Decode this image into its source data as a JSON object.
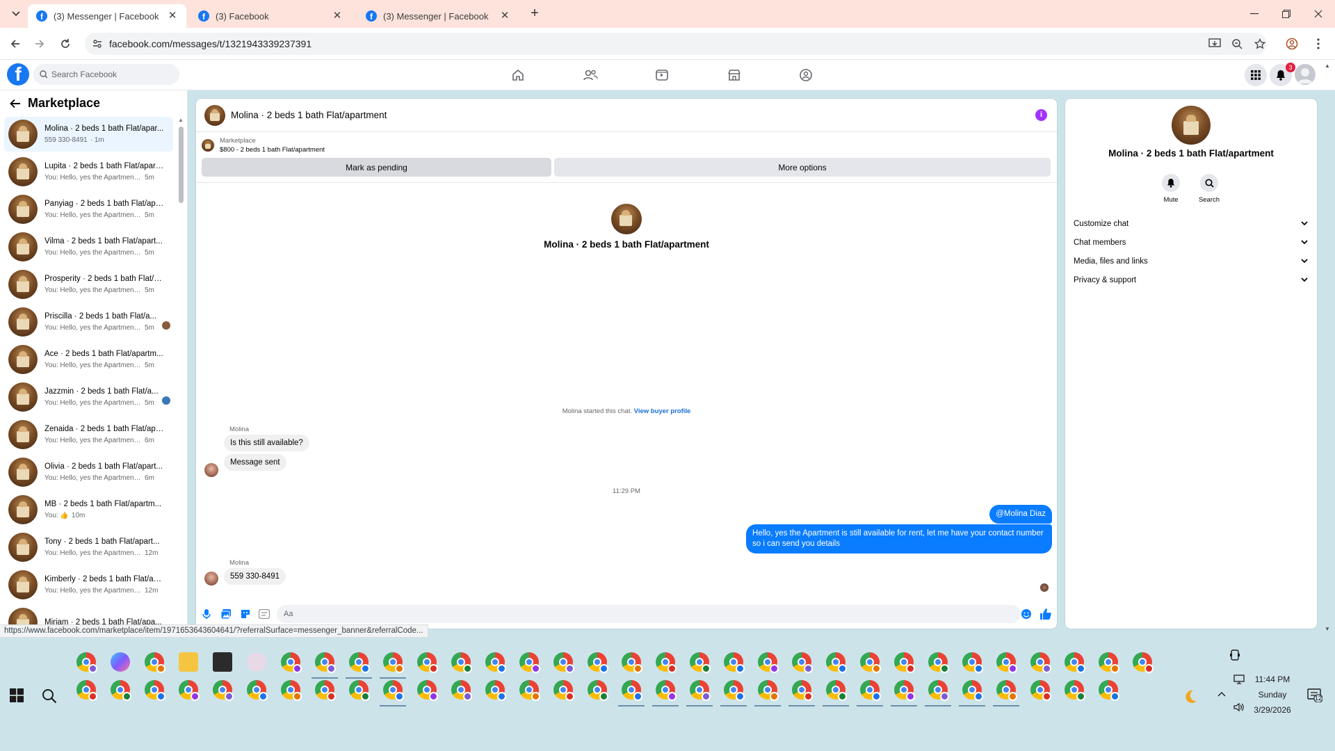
{
  "browser": {
    "tabs": [
      {
        "title": "(3) Messenger | Facebook",
        "active": true
      },
      {
        "title": "(3) Facebook",
        "active": false
      },
      {
        "title": "(3) Messenger | Facebook",
        "active": false
      }
    ],
    "url": "facebook.com/messages/t/1321943339237391",
    "status_url": "https://www.facebook.com/marketplace/item/1971653643604641/?referralSurface=messenger_banner&referralCode..."
  },
  "header": {
    "search_placeholder": "Search Facebook",
    "notification_count": "3"
  },
  "sidebar": {
    "title": "Marketplace",
    "conversations": [
      {
        "name": "Molina · 2 beds 1 bath Flat/apar...",
        "preview": "559 330-8491",
        "time": " · 1m",
        "active": true
      },
      {
        "name": "Lupita · 2 beds 1 bath Flat/apart...",
        "preview": "You: Hello, yes the Apartment is st...",
        "time": "5m"
      },
      {
        "name": "Panyiag · 2 beds 1 bath Flat/apa...",
        "preview": "You: Hello, yes the Apartment is st...",
        "time": "5m"
      },
      {
        "name": "Vilma · 2 beds 1 bath Flat/apart...",
        "preview": "You: Hello, yes the Apartment is st...",
        "time": "5m"
      },
      {
        "name": "Prosperity · 2 beds 1 bath Flat/a...",
        "preview": "You: Hello, yes the Apartment is st...",
        "time": "5m"
      },
      {
        "name": "Priscilla · 2 beds 1 bath Flat/a...",
        "preview": "You: Hello, yes the Apartment i...",
        "time": "5m",
        "seen": "#8a5a3c"
      },
      {
        "name": "Ace · 2 beds 1 bath Flat/apartm...",
        "preview": "You: Hello, yes the Apartment is st...",
        "time": "5m"
      },
      {
        "name": "Jazzmin · 2 beds 1 bath Flat/a...",
        "preview": "You: Hello, yes the Apartment i...",
        "time": "5m",
        "seen": "#3a78b8"
      },
      {
        "name": "Zenaida · 2 beds 1 bath Flat/apa...",
        "preview": "You: Hello, yes the Apartment is st...",
        "time": "6m"
      },
      {
        "name": "Olivia · 2 beds 1 bath Flat/apart...",
        "preview": "You: Hello, yes the Apartment is st...",
        "time": "6m"
      },
      {
        "name": "MB · 2 beds 1 bath Flat/apartm...",
        "preview": "You: 👍",
        "time": "10m"
      },
      {
        "name": "Tony · 2 beds 1 bath Flat/apart...",
        "preview": "You: Hello, yes the Apartment is ...",
        "time": "12m"
      },
      {
        "name": "Kimberly · 2 beds 1 bath Flat/ap...",
        "preview": "You: Hello, yes the Apartment is ...",
        "time": "12m"
      },
      {
        "name": "Miriam · 2 beds 1 bath Flat/apa...",
        "preview": "",
        "time": ""
      }
    ]
  },
  "chat": {
    "title": "Molina · 2 beds 1 bath Flat/apartment",
    "marketplace_label": "Marketplace",
    "listing": "$800 - 2 beds 1 bath Flat/apartment",
    "mark_pending": "Mark as pending",
    "more_options": "More options",
    "center_name": "Molina · 2 beds 1 bath Flat/apartment",
    "started_text": "Molina started this chat.",
    "view_profile": "View buyer profile",
    "sender1": "Molina",
    "msg1": "Is this still available?",
    "msg2": "Message sent",
    "timestamp": "11:29 PM",
    "out_mention": "@Molina Diaz",
    "out_msg": "Hello, yes the Apartment is still available for rent, let me have your contact number so i can send you details",
    "sender2": "Molina",
    "msg3": "559 330-8491",
    "composer_placeholder": "Aa"
  },
  "details": {
    "name": "Molina · 2 beds 1 bath Flat/apartment",
    "mute": "Mute",
    "search": "Search",
    "sections": [
      "Customize chat",
      "Chat members",
      "Media, files and links",
      "Privacy & support"
    ]
  },
  "taskbar": {
    "time": "11:44 PM",
    "day": "Sunday",
    "date": "3/29/2026",
    "notif_count": "12"
  },
  "colors": {
    "fb_blue": "#1877f2",
    "messenger_blue": "#0a7cff",
    "tab_bar": "#fde3dc",
    "taskbar": "#cde3ea"
  }
}
